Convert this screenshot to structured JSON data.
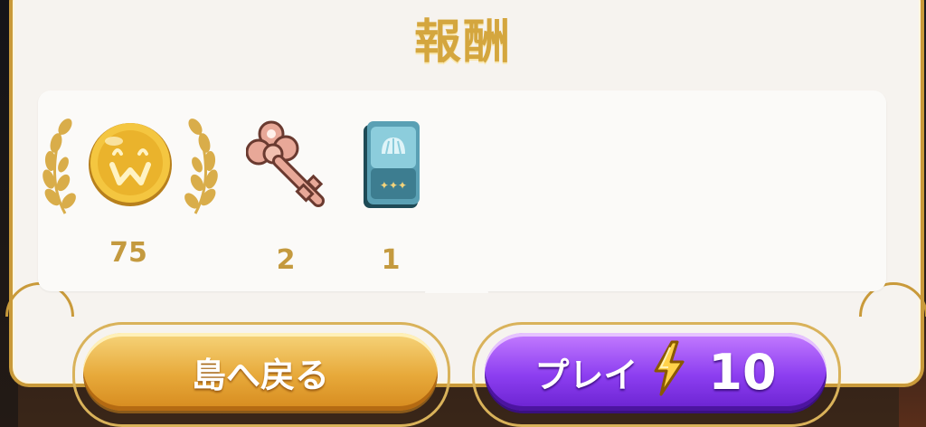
{
  "title": "報酬",
  "rewards": [
    {
      "name": "coin",
      "icon": "coin-with-laurel-icon",
      "count": "75"
    },
    {
      "name": "key",
      "icon": "key-icon",
      "count": "2"
    },
    {
      "name": "card",
      "icon": "card-pack-icon",
      "count": "1"
    }
  ],
  "buttons": {
    "back_label": "島へ戻る",
    "play_label": "プレイ",
    "play_cost": "10"
  },
  "colors": {
    "gold": "#d4a63e",
    "purple": "#8c3ef0",
    "orange": "#e7a93a"
  }
}
